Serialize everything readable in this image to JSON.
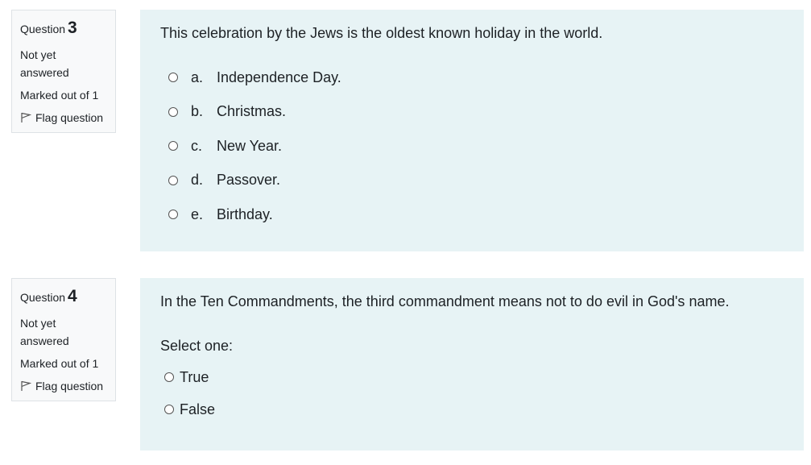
{
  "q3": {
    "info": {
      "question_label": "Question",
      "number": "3",
      "state": "Not yet answered",
      "grade": "Marked out of 1",
      "flag_label": "Flag question"
    },
    "text": "This celebration by the Jews is the oldest known holiday in the world.",
    "options": [
      {
        "letter": "a.",
        "text": "Independence Day."
      },
      {
        "letter": "b.",
        "text": "Christmas."
      },
      {
        "letter": "c.",
        "text": "New Year."
      },
      {
        "letter": "d.",
        "text": "Passover."
      },
      {
        "letter": "e.",
        "text": "Birthday."
      }
    ]
  },
  "q4": {
    "info": {
      "question_label": "Question",
      "number": "4",
      "state": "Not yet answered",
      "grade": "Marked out of 1",
      "flag_label": "Flag question"
    },
    "text": "In the Ten Commandments, the third commandment means not to do evil in God's name.",
    "prompt": "Select one:",
    "options": [
      {
        "text": "True"
      },
      {
        "text": "False"
      }
    ]
  },
  "colors": {
    "content_bg": "#e7f3f5",
    "info_bg": "#f8f9fa",
    "info_border": "#dee2e6"
  },
  "icons": {
    "flag": "flag-icon"
  }
}
